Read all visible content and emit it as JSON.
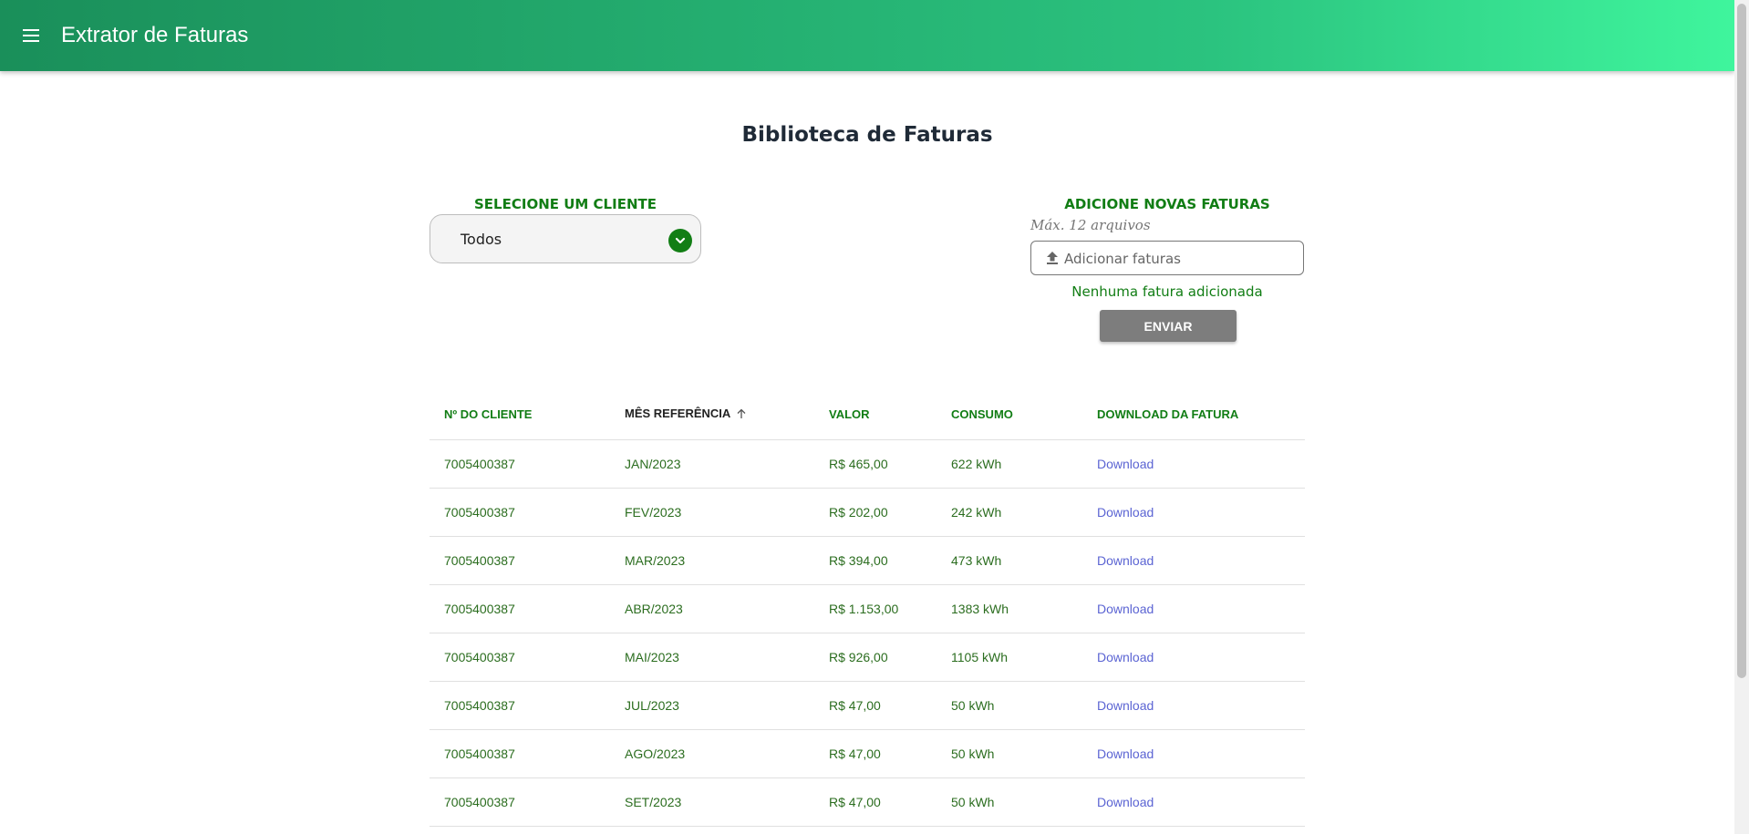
{
  "appbar": {
    "title": "Extrator de Faturas",
    "menu_icon": "hamburger-menu-icon"
  },
  "page": {
    "title": "Biblioteca de Faturas"
  },
  "client_select": {
    "label": "SELECIONE UM CLIENTE",
    "value": "Todos",
    "icon": "chevron-down-icon"
  },
  "upload": {
    "label": "ADICIONE NOVAS FATURAS",
    "hint": "Máx. 12 arquivos",
    "placeholder": "Adicionar faturas",
    "icon": "upload-icon",
    "status": "Nenhuma fatura adicionada",
    "send_label": "ENVIAR"
  },
  "table": {
    "headers": [
      "Nº DO CLIENTE",
      "MÊS REFERÊNCIA",
      "VALOR",
      "CONSUMO",
      "DOWNLOAD DA FATURA"
    ],
    "sorted_column": "MÊS REFERÊNCIA",
    "sort_direction": "ascending",
    "rows": [
      [
        "7005400387",
        "JAN/2023",
        "R$ 465,00",
        "622 kWh",
        "Download"
      ],
      [
        "7005400387",
        "FEV/2023",
        "R$ 202,00",
        "242 kWh",
        "Download"
      ],
      [
        "7005400387",
        "MAR/2023",
        "R$ 394,00",
        "473 kWh",
        "Download"
      ],
      [
        "7005400387",
        "ABR/2023",
        "R$ 1.153,00",
        "1383 kWh",
        "Download"
      ],
      [
        "7005400387",
        "MAI/2023",
        "R$ 926,00",
        "1105 kWh",
        "Download"
      ],
      [
        "7005400387",
        "JUL/2023",
        "R$ 47,00",
        "50 kWh",
        "Download"
      ],
      [
        "7005400387",
        "AGO/2023",
        "R$ 47,00",
        "50 kWh",
        "Download"
      ],
      [
        "7005400387",
        "SET/2023",
        "R$ 47,00",
        "50 kWh",
        "Download"
      ]
    ]
  },
  "colors": {
    "brand_green": "#117d14",
    "appbar_start": "#1a8f5a",
    "appbar_end": "#3ff59d",
    "link": "#5b64d3"
  }
}
